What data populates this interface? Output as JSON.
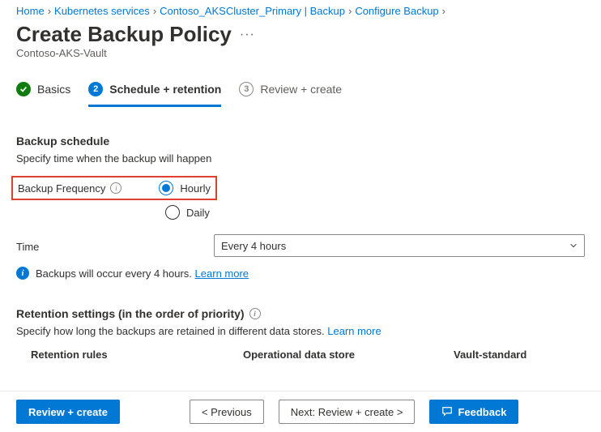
{
  "breadcrumbs": {
    "items": [
      "Home",
      "Kubernetes services",
      "Contoso_AKSCluster_Primary | Backup",
      "Configure Backup"
    ]
  },
  "header": {
    "title": "Create Backup Policy",
    "subtitle": "Contoso-AKS-Vault"
  },
  "tabs": {
    "items": [
      {
        "num": "",
        "label": "Basics",
        "state": "done"
      },
      {
        "num": "2",
        "label": "Schedule + retention",
        "state": "current"
      },
      {
        "num": "3",
        "label": "Review + create",
        "state": "upcoming"
      }
    ]
  },
  "schedule": {
    "heading": "Backup schedule",
    "desc": "Specify time when the backup will happen",
    "freq_label": "Backup Frequency",
    "options": {
      "hourly": "Hourly",
      "daily": "Daily"
    },
    "selected": "hourly",
    "time_label": "Time",
    "time_value": "Every 4 hours",
    "info_text": "Backups will occur every 4 hours.",
    "learn_more": "Learn more"
  },
  "retention": {
    "heading": "Retention settings (in the order of priority)",
    "desc_prefix": "Specify how long the backups are retained in different data stores.",
    "learn_more": "Learn more",
    "cols": {
      "rules": "Retention rules",
      "ods": "Operational data store",
      "vs": "Vault-standard"
    }
  },
  "footer": {
    "review": "Review + create",
    "previous": "<  Previous",
    "next": "Next: Review + create  >",
    "feedback": "Feedback"
  }
}
